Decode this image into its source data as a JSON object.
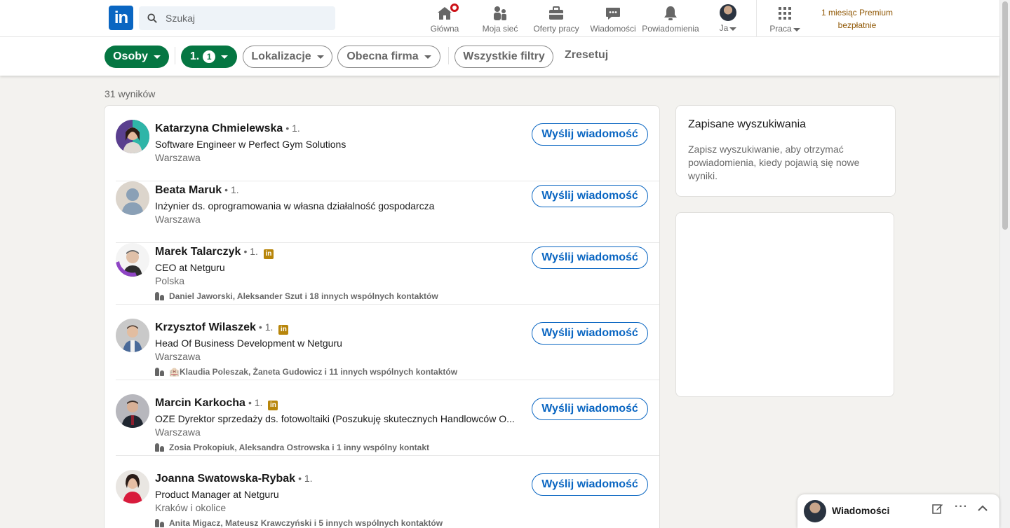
{
  "nav": {
    "search_placeholder": "Szukaj",
    "items": [
      {
        "label": "Główna",
        "icon": "home-icon"
      },
      {
        "label": "Moja sieć",
        "icon": "network-icon"
      },
      {
        "label": "Oferty pracy",
        "icon": "briefcase-icon"
      },
      {
        "label": "Wiadomości",
        "icon": "messaging-icon"
      },
      {
        "label": "Powiadomienia",
        "icon": "bell-icon"
      },
      {
        "label": "Ja",
        "icon": "avatar"
      },
      {
        "label": "Praca",
        "icon": "grid-icon"
      }
    ],
    "premium_line1": "1 miesiąc Premium",
    "premium_line2": "bezpłatnie"
  },
  "filters": {
    "people": "Osoby",
    "connections": "1.",
    "connections_count": "1",
    "locations": "Lokalizacje",
    "company": "Obecna firma",
    "all": "Wszystkie filtry",
    "reset": "Zresetuj"
  },
  "results_count": "31 wyników",
  "results": [
    {
      "name": "Katarzyna Chmielewska",
      "degree": "• 1.",
      "headline": "Software Engineer w Perfect Gym Solutions",
      "location": "Warszawa",
      "shared": "",
      "premium": false,
      "button": "Wyślij wiadomość"
    },
    {
      "name": "Beata Maruk",
      "degree": "• 1.",
      "headline": "Inżynier ds. oprogramowania w własna działalność gospodarcza",
      "location": "Warszawa",
      "shared": "",
      "premium": false,
      "button": "Wyślij wiadomość"
    },
    {
      "name": "Marek Talarczyk",
      "degree": "• 1.",
      "headline": "CEO at Netguru",
      "location": "Polska",
      "shared": "Daniel Jaworski, Aleksander Szut i 18 innych wspólnych kontaktów",
      "premium": true,
      "button": "Wyślij wiadomość"
    },
    {
      "name": "Krzysztof Wilaszek",
      "degree": "• 1.",
      "headline": "Head Of Business Development w Netguru",
      "location": "Warszawa",
      "shared": "🏨Klaudia Poleszak, Żaneta Gudowicz i 11 innych wspólnych kontaktów",
      "premium": true,
      "button": "Wyślij wiadomość"
    },
    {
      "name": "Marcin Karkocha",
      "degree": "• 1.",
      "headline": "OZE Dyrektor sprzedaży ds. fotowoltaiki (Poszukuję skutecznych Handlowców O...",
      "location": "Warszawa",
      "shared": "Zosia Prokopiuk, Aleksandra Ostrowska i 1 inny wspólny kontakt",
      "premium": true,
      "button": "Wyślij wiadomość"
    },
    {
      "name": "Joanna Swatowska-Rybak",
      "degree": "• 1.",
      "headline": "Product Manager at Netguru",
      "location": "Kraków i okolice",
      "shared": "Anita Migacz, Mateusz Krawczyński i 5 innych wspólnych kontaktów",
      "premium": false,
      "button": "Wyślij wiadomość"
    }
  ],
  "saved_searches": {
    "title": "Zapisane wyszukiwania",
    "description": "Zapisz wyszukiwanie, aby otrzymać powiadomienia, kiedy pojawią się nowe wyniki."
  },
  "messaging": {
    "title": "Wiadomości"
  },
  "colors": {
    "brand": "#0a66c2",
    "green": "#057642",
    "premium": "#915907",
    "notification": "#cc1016"
  }
}
